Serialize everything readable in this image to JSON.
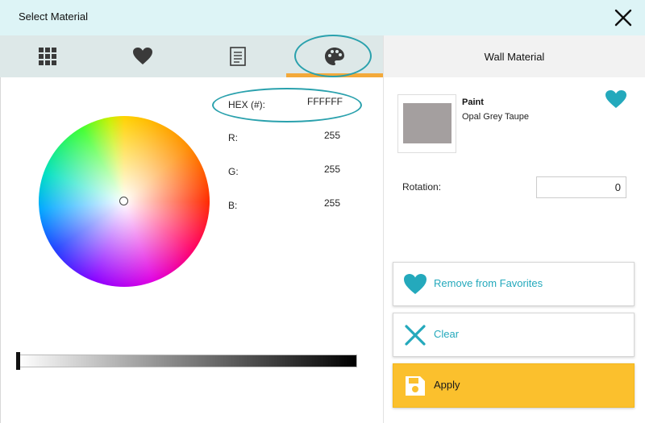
{
  "window": {
    "title": "Select Material",
    "close_icon": "close-icon"
  },
  "tabs": [
    {
      "name": "Catalog",
      "icon": "grid-icon",
      "selected": false
    },
    {
      "name": "Favorites",
      "icon": "heart-icon",
      "selected": false
    },
    {
      "name": "Details",
      "icon": "document-icon",
      "selected": false
    },
    {
      "name": "Color",
      "icon": "palette-icon",
      "selected": true
    }
  ],
  "color_picker": {
    "hex_label": "HEX (#):",
    "hex_value": "FFFFFF",
    "r_label": "R:",
    "r_value": "255",
    "g_label": "G:",
    "g_value": "255",
    "b_label": "B:",
    "b_value": "255",
    "brightness_level": 0.0
  },
  "details": {
    "header": "Wall Material",
    "material_type": "Paint",
    "material_name": "Opal Grey Taupe",
    "swatch_color": "#a49f9f",
    "rotation_label": "Rotation:",
    "rotation_value": "0"
  },
  "actions": {
    "remove_favorites_label": "Remove from Favorites",
    "clear_label": "Clear",
    "apply_label": "Apply"
  },
  "colors": {
    "accent_teal": "#24a9bc",
    "tab_underline": "#f3a93a",
    "apply_yellow": "#fbc02d",
    "title_bar": "#ddf4f6"
  }
}
